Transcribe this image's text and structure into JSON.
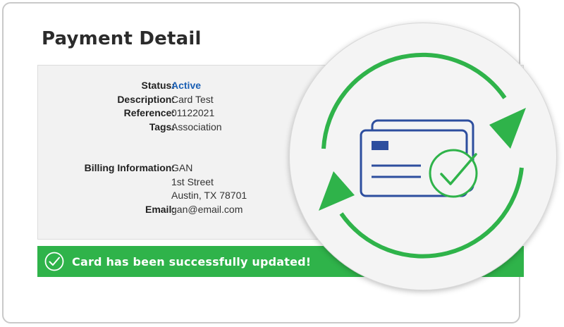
{
  "page": {
    "title": "Payment Detail"
  },
  "details": {
    "status_label": "Status:",
    "status_value": "Active",
    "description_label": "Description:",
    "description_value": "Card Test",
    "reference_label": "Reference:",
    "reference_value": "01122021",
    "tags_label": "Tags:",
    "tags_value": "Association",
    "billing_label": "Billing Information:",
    "billing_name": "GAN",
    "billing_street": "1st Street",
    "billing_city": "Austin, TX 78701",
    "email_label": "Email:",
    "email_value": "gan@email.com"
  },
  "notification": {
    "message": "Card has been successfully updated!",
    "icon": "check-circle-icon"
  },
  "badge": {
    "icon": "card-sync-icon"
  },
  "colors": {
    "success": "#2fb34a",
    "status_active": "#1a5fb4",
    "card_outline": "#2d4e9e",
    "arrow_green": "#2fb34a"
  }
}
